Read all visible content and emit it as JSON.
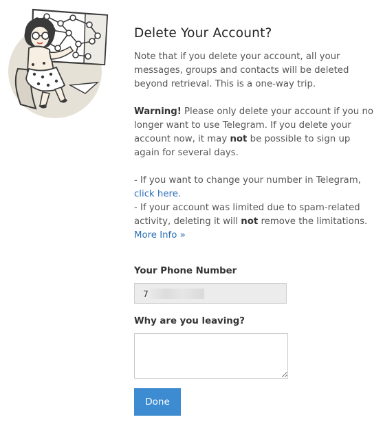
{
  "illustration": {
    "icon": "telegram-girl-map-illustration"
  },
  "heading": "Delete Your Account?",
  "intro": "Note that if you delete your account, all your messages, groups and contacts will be deleted beyond retrieval. This is a one-way trip.",
  "warning": {
    "label": "Warning!",
    "text_before_not": " Please only delete your account if you no longer want to use Telegram. If you delete your account now, it may ",
    "not": "not",
    "text_after_not": " be possible to sign up again for several days."
  },
  "change_number": {
    "text": "- If you want to change your number in Telegram, ",
    "link": "click here."
  },
  "spam_info": {
    "text_before_not": "- If your account was limited due to spam-related activity, deleting it will ",
    "not": "not",
    "text_after_not": " remove the limitations.",
    "link": "More Info »"
  },
  "phone": {
    "label": "Your Phone Number",
    "value": "7"
  },
  "reason": {
    "label": "Why are you leaving?",
    "value": ""
  },
  "done_button": "Done",
  "colors": {
    "link": "#2a6fb5",
    "button": "#3d8bd0",
    "illustration_bg": "#e6e1d6"
  }
}
